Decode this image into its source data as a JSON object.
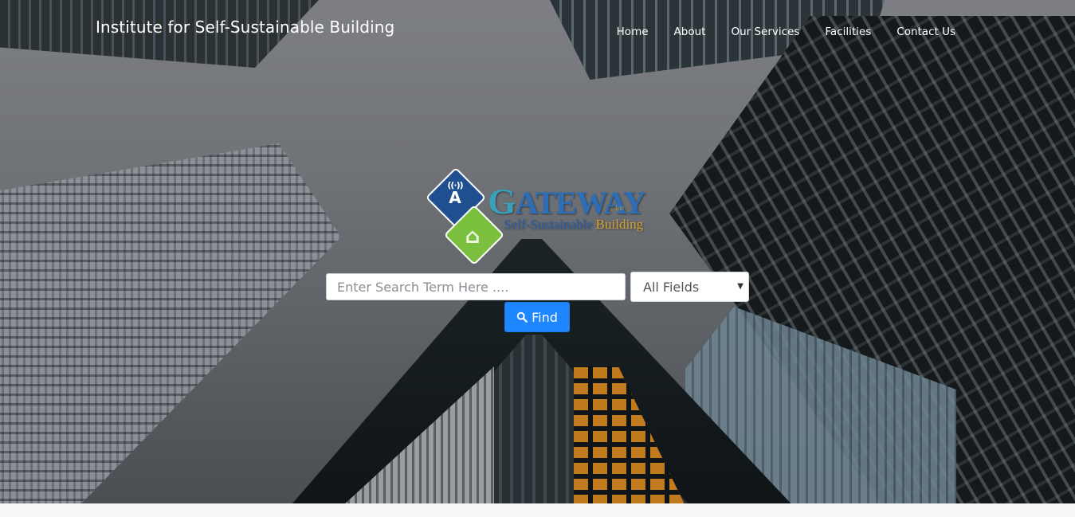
{
  "header": {
    "brand": "Institute for Self-Sustainable Building",
    "nav": [
      "Home",
      "About",
      "Our Services",
      "Facilities",
      "Contact Us"
    ]
  },
  "logo": {
    "title_initial": "G",
    "title_rest": "ATEWAY",
    "title_for": "for",
    "subtitle_left": "Self-Sustainable",
    "subtitle_right": "Building",
    "icons": [
      "antenna-icon",
      "smart-home-icon"
    ]
  },
  "search": {
    "placeholder": "Enter Search Term Here ....",
    "field_selected": "All Fields",
    "find_label": "Find"
  },
  "colors": {
    "accent": "#1e86ff",
    "logo_blue": "#1f4f8f",
    "logo_green": "#7bbf3f",
    "logo_gold": "#d5a234"
  }
}
